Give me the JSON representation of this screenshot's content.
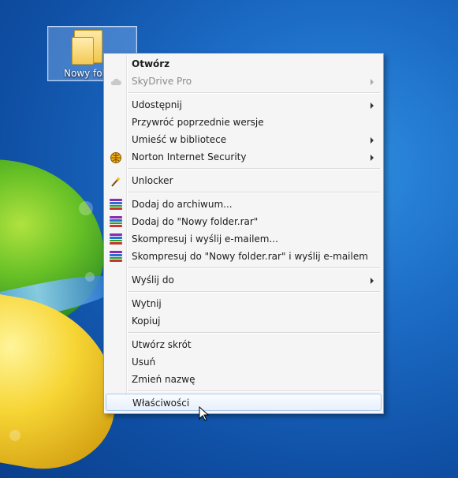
{
  "desktop": {
    "icon_label": "Nowy folder"
  },
  "menu": {
    "items": [
      {
        "label": "Otwórz",
        "style": "bold"
      },
      {
        "label": "SkyDrive Pro",
        "style": "disabled",
        "submenu": true,
        "icon": "cloud-icon"
      },
      {
        "label": "Udostępnij",
        "submenu": true
      },
      {
        "label": "Przywróć poprzednie wersje"
      },
      {
        "label": "Umieść w bibliotece",
        "submenu": true
      },
      {
        "label": "Norton Internet Security",
        "submenu": true,
        "icon": "norton-icon"
      },
      {
        "label": "Unlocker",
        "icon": "unlocker-wand-icon"
      },
      {
        "label": "Dodaj do archiwum...",
        "icon": "winrar-icon"
      },
      {
        "label": "Dodaj do \"Nowy folder.rar\"",
        "icon": "winrar-icon"
      },
      {
        "label": "Skompresuj i wyślij e-mailem...",
        "icon": "winrar-icon"
      },
      {
        "label": "Skompresuj do \"Nowy folder.rar\" i wyślij e-mailem",
        "icon": "winrar-icon"
      },
      {
        "label": "Wyślij do",
        "submenu": true
      },
      {
        "label": "Wytnij"
      },
      {
        "label": "Kopiuj"
      },
      {
        "label": "Utwórz skrót"
      },
      {
        "label": "Usuń"
      },
      {
        "label": "Zmień nazwę"
      },
      {
        "label": "Właściwości",
        "state": "hover"
      }
    ]
  },
  "colors": {
    "desktop_bg": "#1c6cc6",
    "menu_bg": "#f5f5f5",
    "hover_border": "#a9c6ea"
  }
}
